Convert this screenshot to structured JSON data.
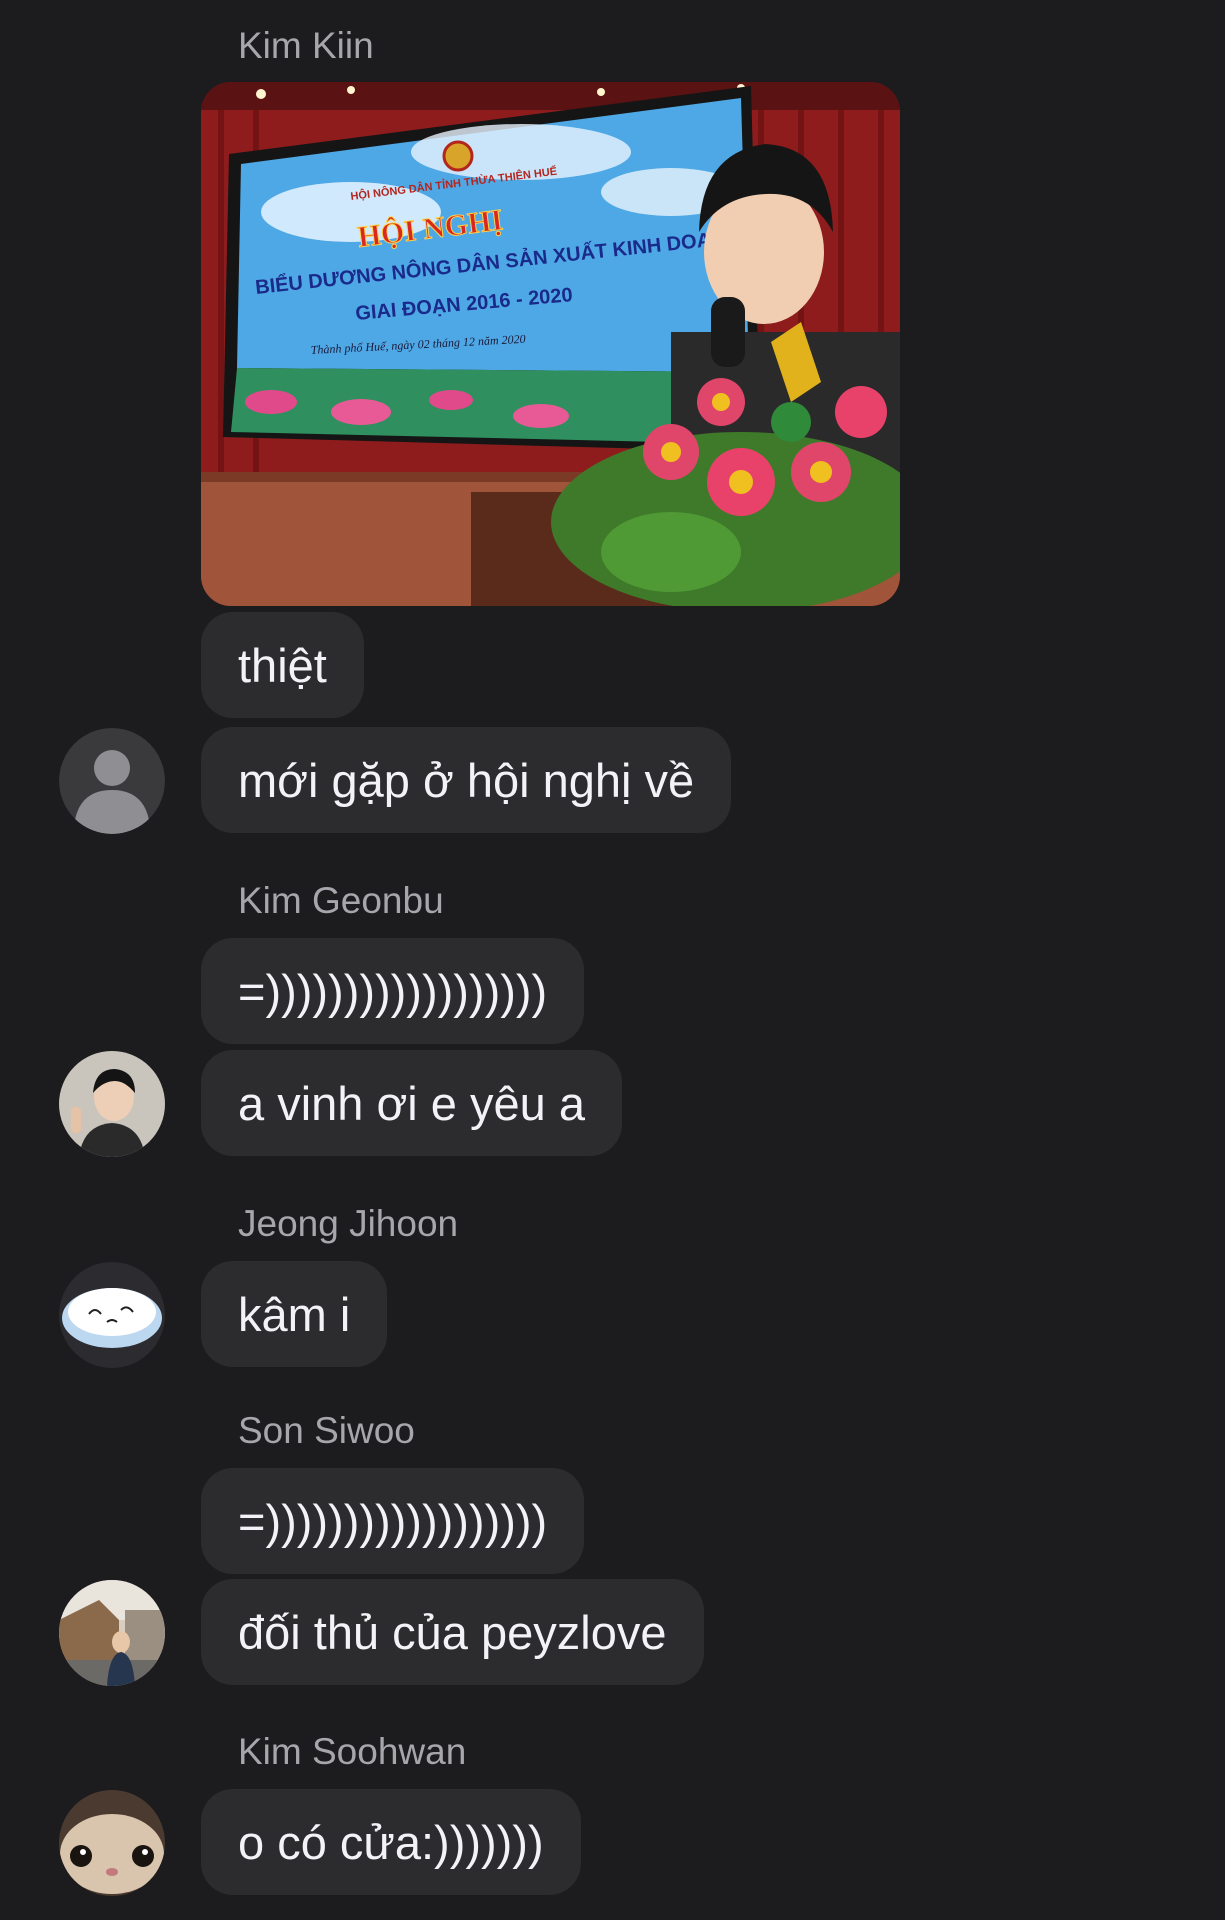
{
  "messages": {
    "kim_kiin": {
      "sender": "Kim Kiin",
      "image": {
        "screen_line1": "HỘI NÔNG DÂN TỈNH THỪA THIÊN HUẾ",
        "screen_title": "HỘI NGHỊ",
        "screen_line2": "BIỂU DƯƠNG NÔNG DÂN SẢN XUẤT KINH DOANH GIỎI",
        "screen_line3": "GIAI ĐOẠN 2016 - 2020",
        "screen_line4": "Thành phố Huế, ngày 02 tháng 12 năm 2020"
      },
      "text1": "thiệt",
      "text2": "mới gặp ở hội nghị về"
    },
    "kim_geonbu": {
      "sender": "Kim Geonbu",
      "text1": "=))))))))))))))))))",
      "text2": "a vinh ơi e yêu a"
    },
    "jeong_jihoon": {
      "sender": "Jeong Jihoon",
      "text1": "kâm i"
    },
    "son_siwoo": {
      "sender": "Son Siwoo",
      "text1": "=))))))))))))))))))",
      "text2": "đối thủ của peyzlove"
    },
    "kim_soohwan": {
      "sender": "Kim Soohwan",
      "text1": "o có cửa:)))))))"
    }
  },
  "colors": {
    "background": "#1c1c1e",
    "bubble": "#2c2c2e",
    "sender_name": "#a6a6ab",
    "message_text": "#f2f2f7"
  }
}
